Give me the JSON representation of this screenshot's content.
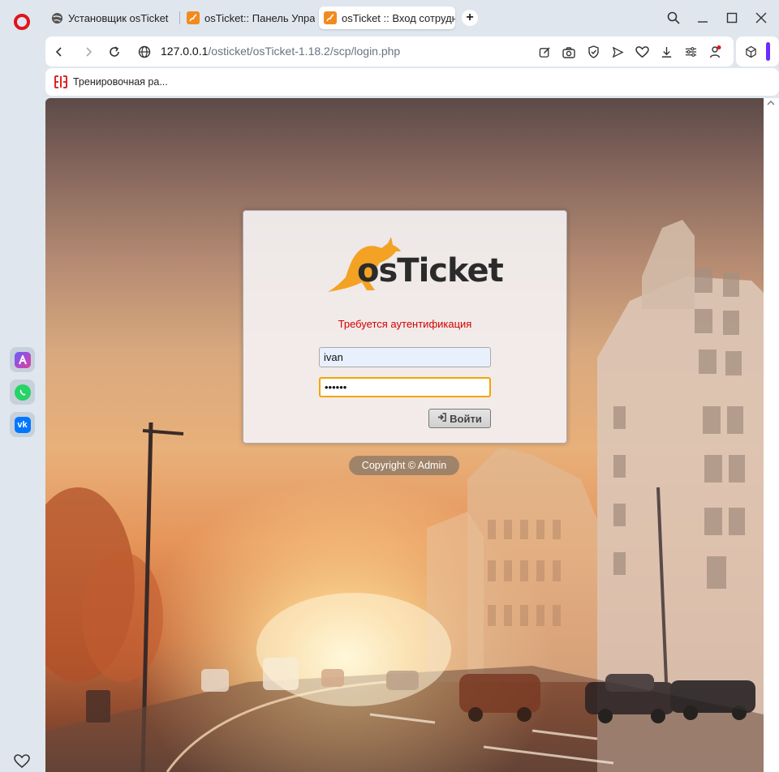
{
  "browser": {
    "tabs": [
      {
        "title": "Установщик osTicket",
        "active": false
      },
      {
        "title": "osTicket:: Панель Управле",
        "active": false
      },
      {
        "title": "osTicket :: Вход сотрудни",
        "active": true
      }
    ],
    "new_tab": "+",
    "url": {
      "host": "127.0.0.1",
      "path": "/osticket/osTicket-1.18.2/scp/login.php"
    },
    "bookmarks": [
      {
        "label": "Тренировочная ра..."
      }
    ],
    "accent": "#e0141e"
  },
  "sidebar": {
    "apps": [
      {
        "name": "aria-icon",
        "color": "#8a4dff"
      },
      {
        "name": "whatsapp-icon",
        "color": "#25d366"
      },
      {
        "name": "vk-icon",
        "color": "#0077ff",
        "text": "vk"
      }
    ]
  },
  "page": {
    "logo_text": "osTicket",
    "auth_message": "Требуется аутентификация",
    "username": {
      "value": "ivan",
      "placeholder": ""
    },
    "password": {
      "value": "••••••",
      "placeholder": ""
    },
    "login_button": "Войти",
    "copyright": "Copyright © Admin"
  }
}
